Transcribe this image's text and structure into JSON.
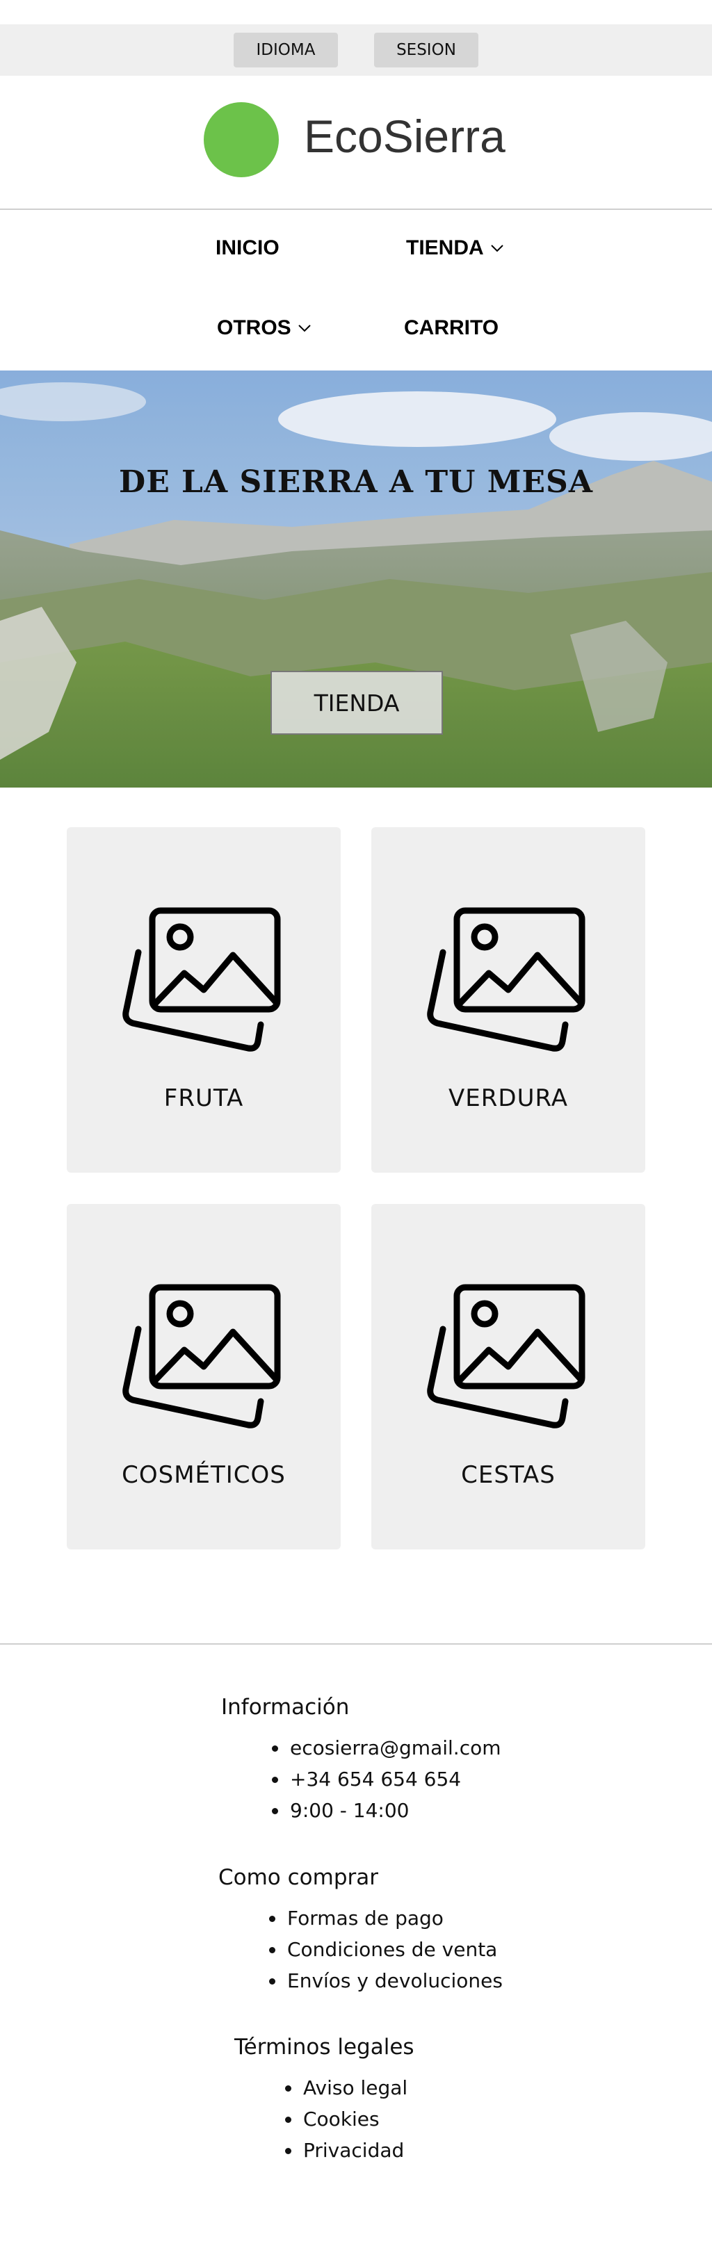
{
  "topbar": {
    "idioma_label": "IDIOMA",
    "sesion_label": "SESION"
  },
  "brand": {
    "name": "EcoSierra",
    "logo_color": "#6cc24a"
  },
  "nav": {
    "inicio": "INICIO",
    "tienda": "TIENDA",
    "otros": "OTROS",
    "carrito": "CARRITO"
  },
  "hero": {
    "title": "DE LA SIERRA A TU MESA",
    "button_label": "TIENDA"
  },
  "categories": [
    {
      "label": "FRUTA",
      "icon": "image-gallery-icon"
    },
    {
      "label": "VERDURA",
      "icon": "image-gallery-icon"
    },
    {
      "label": "COSMÉTICOS",
      "icon": "image-gallery-icon"
    },
    {
      "label": "CESTAS",
      "icon": "image-gallery-icon"
    }
  ],
  "footer": {
    "info": {
      "title": "Información",
      "items": [
        "ecosierra@gmail.com",
        "+34 654 654 654",
        "9:00 - 14:00"
      ]
    },
    "comprar": {
      "title": "Como comprar",
      "items": [
        "Formas de pago",
        "Condiciones de venta",
        "Envíos y devoluciones"
      ]
    },
    "legal": {
      "title": "Términos legales",
      "items": [
        "Aviso legal",
        "Cookies",
        "Privacidad"
      ]
    }
  }
}
